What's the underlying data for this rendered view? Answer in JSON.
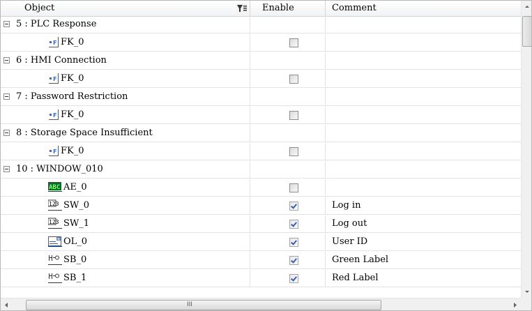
{
  "columns": {
    "object": "Object",
    "enable": "Enable",
    "comment": "Comment"
  },
  "icons": {
    "filter": "filter-icon",
    "collapse": "minus-box-icon",
    "function_key": "function-key-icon",
    "ascii_entry": "ascii-entry-icon",
    "numeric_switch": "numeric-switch-icon",
    "option_list": "option-list-icon",
    "bit_button": "bit-button-icon",
    "scrollbar_grip": "III"
  },
  "rows": [
    {
      "type": "group",
      "label": "5 : PLC Response"
    },
    {
      "type": "item",
      "icon": "function-key-icon",
      "name": "FK_0",
      "enabled": false,
      "comment": ""
    },
    {
      "type": "group",
      "label": "6 : HMI Connection"
    },
    {
      "type": "item",
      "icon": "function-key-icon",
      "name": "FK_0",
      "enabled": false,
      "comment": ""
    },
    {
      "type": "group",
      "label": "7 : Password Restriction"
    },
    {
      "type": "item",
      "icon": "function-key-icon",
      "name": "FK_0",
      "enabled": false,
      "comment": ""
    },
    {
      "type": "group",
      "label": "8 : Storage Space Insufficient"
    },
    {
      "type": "item",
      "icon": "function-key-icon",
      "name": "FK_0",
      "enabled": false,
      "comment": ""
    },
    {
      "type": "group",
      "label": "10 : WINDOW_010"
    },
    {
      "type": "item",
      "icon": "ascii-entry-icon",
      "name": "AE_0",
      "enabled": false,
      "comment": ""
    },
    {
      "type": "item",
      "icon": "numeric-switch-icon",
      "name": "SW_0",
      "enabled": true,
      "comment": "Log in"
    },
    {
      "type": "item",
      "icon": "numeric-switch-icon",
      "name": "SW_1",
      "enabled": true,
      "comment": "Log out"
    },
    {
      "type": "item",
      "icon": "option-list-icon",
      "name": "OL_0",
      "enabled": true,
      "comment": "User ID"
    },
    {
      "type": "item",
      "icon": "bit-button-icon",
      "name": "SB_0",
      "enabled": true,
      "comment": "Green Label"
    },
    {
      "type": "item",
      "icon": "bit-button-icon",
      "name": "SB_1",
      "enabled": true,
      "comment": "Red Label"
    }
  ]
}
